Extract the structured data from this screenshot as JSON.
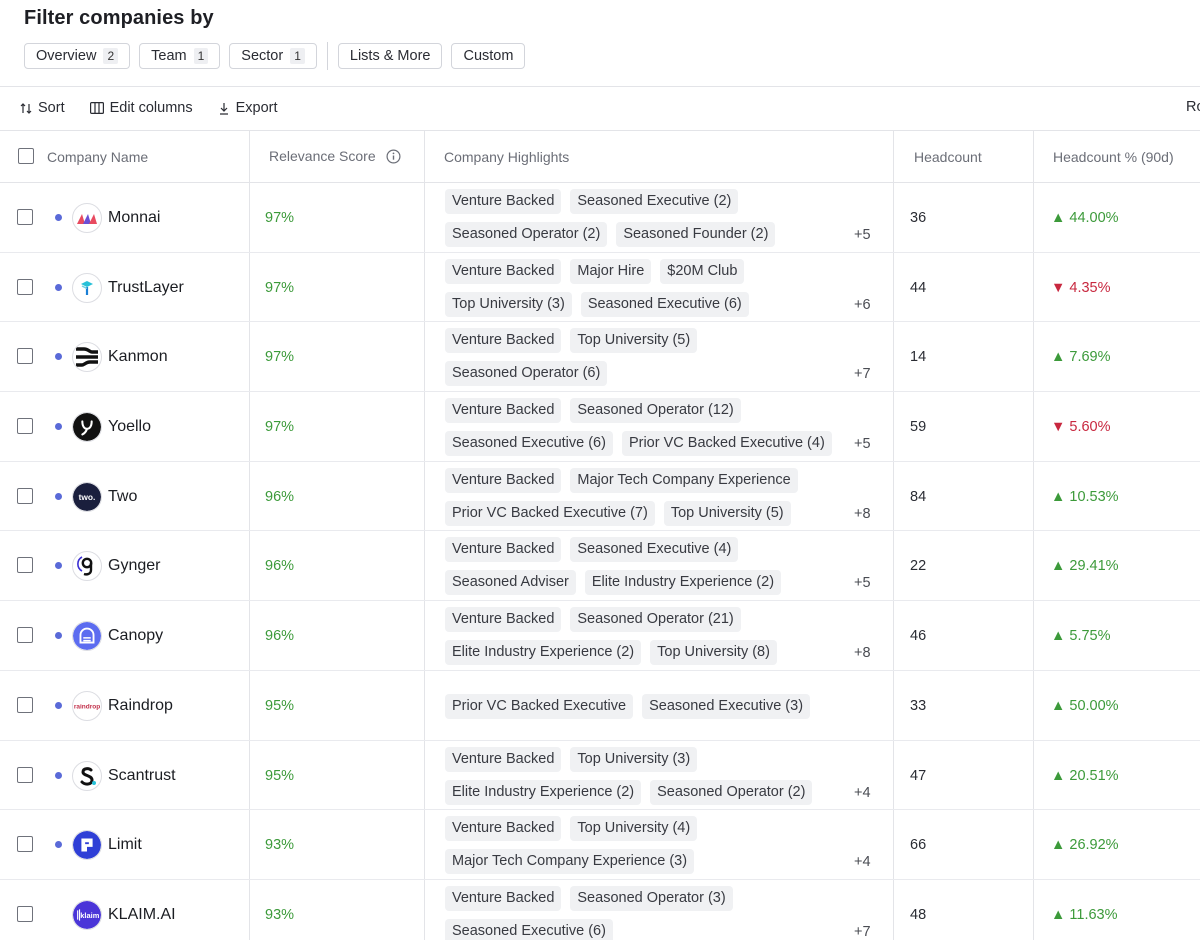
{
  "filter": {
    "title": "Filter companies by",
    "chips": [
      {
        "label": "Overview",
        "count": "2"
      },
      {
        "label": "Team",
        "count": "1"
      },
      {
        "label": "Sector",
        "count": "1"
      },
      {
        "label": "Lists & More",
        "count": ""
      },
      {
        "label": "Custom",
        "count": ""
      }
    ]
  },
  "toolbar": {
    "sort": "Sort",
    "edit_columns": "Edit columns",
    "export": "Export",
    "right_cut": "Ro"
  },
  "columns": {
    "company": "Company Name",
    "relevance": "Relevance Score",
    "highlights": "Company Highlights",
    "headcount": "Headcount",
    "headcount_pct": "Headcount % (90d)"
  },
  "colors": {
    "positive": "#3c9a3a",
    "negative": "#c8283f",
    "dot": "#5a6ad8",
    "tag_bg": "#f0f1f3"
  },
  "rows": [
    {
      "name": "Monnai",
      "logo": "monnai-logo",
      "dot": true,
      "score": "97%",
      "tags": [
        [
          "Venture Backed",
          "Seasoned Executive (2)"
        ],
        [
          "Seasoned Operator (2)",
          "Seasoned Founder (2)"
        ]
      ],
      "more": "+5",
      "headcount": "36",
      "pct": "44.00%",
      "trend": "up"
    },
    {
      "name": "TrustLayer",
      "logo": "trustlayer-logo",
      "dot": true,
      "score": "97%",
      "tags": [
        [
          "Venture Backed",
          "Major Hire",
          "$20M Club"
        ],
        [
          "Top University (3)",
          "Seasoned Executive (6)"
        ]
      ],
      "more": "+6",
      "headcount": "44",
      "pct": "4.35%",
      "trend": "down"
    },
    {
      "name": "Kanmon",
      "logo": "kanmon-logo",
      "dot": true,
      "score": "97%",
      "tags": [
        [
          "Venture Backed",
          "Top University (5)"
        ],
        [
          "Seasoned Operator (6)"
        ]
      ],
      "more": "+7",
      "headcount": "14",
      "pct": "7.69%",
      "trend": "up"
    },
    {
      "name": "Yoello",
      "logo": "yoello-logo",
      "dot": true,
      "score": "97%",
      "tags": [
        [
          "Venture Backed",
          "Seasoned Operator (12)"
        ],
        [
          "Seasoned Executive (6)",
          "Prior VC Backed Executive (4)"
        ]
      ],
      "more": "+5",
      "headcount": "59",
      "pct": "5.60%",
      "trend": "down"
    },
    {
      "name": "Two",
      "logo": "two-logo",
      "dot": true,
      "score": "96%",
      "tags": [
        [
          "Venture Backed",
          "Major Tech Company Experience"
        ],
        [
          "Prior VC Backed Executive (7)",
          "Top University (5)"
        ]
      ],
      "more": "+8",
      "headcount": "84",
      "pct": "10.53%",
      "trend": "up"
    },
    {
      "name": "Gynger",
      "logo": "gynger-logo",
      "dot": true,
      "score": "96%",
      "tags": [
        [
          "Venture Backed",
          "Seasoned Executive (4)"
        ],
        [
          "Seasoned Adviser",
          "Elite Industry Experience (2)"
        ]
      ],
      "more": "+5",
      "headcount": "22",
      "pct": "29.41%",
      "trend": "up"
    },
    {
      "name": "Canopy",
      "logo": "canopy-logo",
      "dot": true,
      "score": "96%",
      "tags": [
        [
          "Venture Backed",
          "Seasoned Operator (21)"
        ],
        [
          "Elite Industry Experience (2)",
          "Top University (8)"
        ]
      ],
      "more": "+8",
      "headcount": "46",
      "pct": "5.75%",
      "trend": "up"
    },
    {
      "name": "Raindrop",
      "logo": "raindrop-logo",
      "dot": true,
      "score": "95%",
      "tags": [
        [
          "Prior VC Backed Executive",
          "Seasoned Executive (3)"
        ]
      ],
      "more": "",
      "headcount": "33",
      "pct": "50.00%",
      "trend": "up",
      "logo_text": "raindr•p"
    },
    {
      "name": "Scantrust",
      "logo": "scantrust-logo",
      "dot": true,
      "score": "95%",
      "tags": [
        [
          "Venture Backed",
          "Top University (3)"
        ],
        [
          "Elite Industry Experience (2)",
          "Seasoned Operator (2)"
        ]
      ],
      "more": "+4",
      "headcount": "47",
      "pct": "20.51%",
      "trend": "up"
    },
    {
      "name": "Limit",
      "logo": "limit-logo",
      "dot": true,
      "score": "93%",
      "tags": [
        [
          "Venture Backed",
          "Top University (4)"
        ],
        [
          "Major Tech Company Experience (3)"
        ]
      ],
      "more": "+4",
      "headcount": "66",
      "pct": "26.92%",
      "trend": "up"
    },
    {
      "name": "KLAIM.AI",
      "logo": "klaim-logo",
      "dot": false,
      "score": "93%",
      "tags": [
        [
          "Venture Backed",
          "Seasoned Operator (3)"
        ],
        [
          "Seasoned Executive (6)"
        ]
      ],
      "more": "+7",
      "headcount": "48",
      "pct": "11.63%",
      "trend": "up",
      "logo_text": "klaim"
    }
  ]
}
